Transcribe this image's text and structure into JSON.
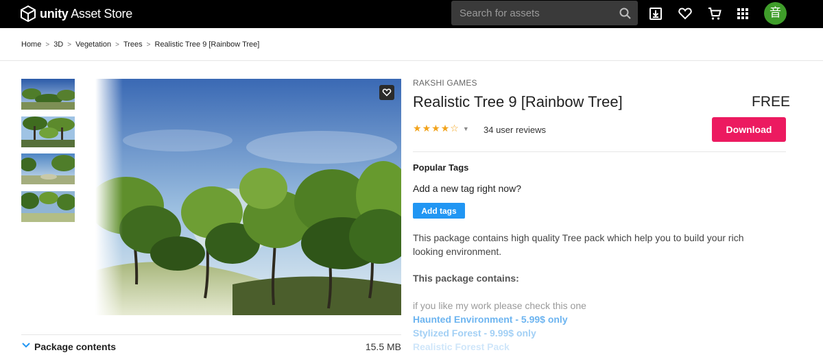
{
  "header": {
    "logo_text": "unity",
    "logo_text_suffix": "Asset Store",
    "search_placeholder": "Search for assets",
    "icons": [
      "downloads-icon",
      "heart-icon",
      "cart-icon",
      "apps-grid-icon"
    ],
    "avatar_initial": "音",
    "avatar_color": "#3f9d2a"
  },
  "breadcrumb": [
    "Home",
    "3D",
    "Vegetation",
    "Trees",
    "Realistic Tree 9 [Rainbow Tree]"
  ],
  "gallery": {
    "thumbnail_count": 4
  },
  "package_contents": {
    "label": "Package contents",
    "size": "15.5 MB"
  },
  "product": {
    "publisher": "RAKSHI GAMES",
    "title": "Realistic Tree 9 [Rainbow Tree]",
    "price": "FREE",
    "rating": 4,
    "rating_max": 5,
    "reviews": "34 user reviews",
    "download_label": "Download",
    "download_color": "#ec1a60"
  },
  "tags": {
    "heading": "Popular Tags",
    "prompt": "Add a new tag right now?",
    "button_label": "Add tags"
  },
  "description": {
    "text": "This package contains high quality Tree pack which help you to build your rich looking environment.",
    "contains_heading": "This package contains:",
    "note": "if you like my work please check this one",
    "links": [
      "Haunted Environment - 5.99$ only",
      "Stylized Forest - 9.99$ only",
      "Realistic Forest Pack"
    ]
  }
}
